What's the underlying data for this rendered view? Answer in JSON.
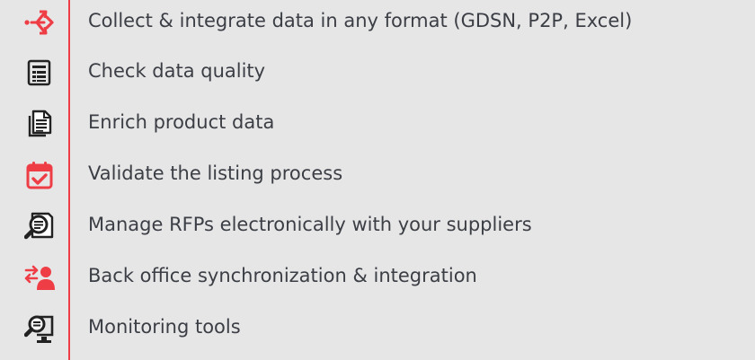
{
  "colors": {
    "accent": "#ef3d46",
    "icon": "#222222",
    "text": "#3b3e44",
    "background": "#e6e6e7"
  },
  "features": [
    {
      "icon": "arrows-split-icon",
      "label": "Collect & integrate data in any format (GDSN, P2P, Excel)"
    },
    {
      "icon": "spreadsheet-icon",
      "label": "Check data quality"
    },
    {
      "icon": "documents-icon",
      "label": "Enrich product data"
    },
    {
      "icon": "calendar-check-icon",
      "label": "Validate the listing process"
    },
    {
      "icon": "magnifier-document-icon",
      "label": "Manage RFPs electronically with your suppliers"
    },
    {
      "icon": "user-sync-icon",
      "label": "Back office synchronization & integration"
    },
    {
      "icon": "monitor-search-icon",
      "label": "Monitoring tools"
    }
  ]
}
